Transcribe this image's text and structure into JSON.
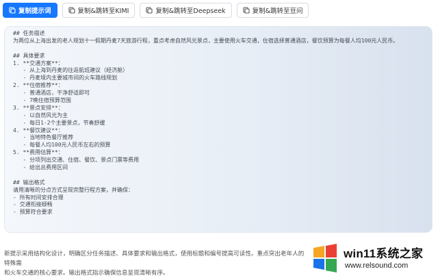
{
  "toolbar": {
    "buttons": [
      {
        "label": "复制提示词",
        "icon": "copy-icon"
      },
      {
        "label": "复制&跳转至KIMI",
        "icon": "copy-icon"
      },
      {
        "label": "复制&跳转至Deepseek",
        "icon": "copy-icon"
      },
      {
        "label": "复制&跳转至豆问",
        "icon": "copy-icon"
      }
    ]
  },
  "prompt": {
    "lines": [
      "## 任务描述",
      "为两位从上海出发的老人规划十一假期丹麦7天旅游行程，重点考虑自然风光景点，主要使用火车交通，住宿选择普通酒店，餐饮预算为每餐人均100元人民币。",
      "",
      "## 具体要求",
      "1. **交通方案**：",
      "   - 从上海到丹麦的往返航班建议（经济舱）",
      "   - 丹麦境内主要城市间的火车路线规划",
      "2. **住宿推荐**：",
      "   - 普通酒店，干净舒适即可",
      "   - 7晚住宿预算范围",
      "3. **景点安排**：",
      "   - 以自然风光为主",
      "   - 每日1-2个主要景点，节奏舒缓",
      "4. **餐饮建议**：",
      "   - 当地特色餐厅推荐",
      "   - 每餐人均100元人民币左右的预算",
      "5. **费用估算**：",
      "   - 分项列出交通、住宿、餐饮、景点门票等费用",
      "   - 给出总费用区间",
      "",
      "## 输出格式",
      "请用清晰的分点方式呈现完整行程方案，并确保：",
      "- 所有时间安排合理",
      "- 交通衔接顺畅",
      "- 预算符合要求"
    ]
  },
  "caption": {
    "lines": [
      "新提示采用结构化设计，明确区分任务描述、具体要求和输出格式，使用标题和编号提高可读性。重点突出老年人的特殊需",
      "和火车交通的核心要求。输出格式指示确保信息呈现清晰有序。"
    ]
  },
  "watermark": {
    "title": "win11系统之家",
    "url": "www.relsound.com",
    "logo_colors": [
      "#f5a623",
      "#e94235",
      "#1a73e8",
      "#34a853"
    ]
  }
}
